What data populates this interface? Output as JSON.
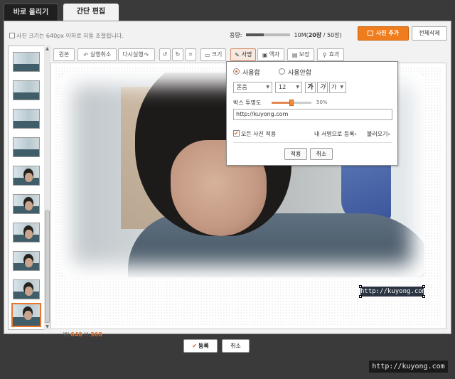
{
  "tabs": {
    "upload": "바로 올리기",
    "edit": "간단 편집"
  },
  "topbar": {
    "note": "사진 크기는 640px 이하로 자동 조절됩니다.",
    "capacity_label": "용량:",
    "capacity_total": "10M",
    "photo_count_open": "(",
    "photo_count_current": "20장",
    "photo_count_rest": " / 50장)",
    "capacity_fill": 0.4,
    "add_photo": "사진 추가",
    "delete_all": "전체삭제"
  },
  "toolbar": {
    "original": "원본",
    "undo": "실행취소",
    "redo": "다시실행",
    "resize": "크기",
    "signature": "서명",
    "stamp": "액자",
    "correct": "보정",
    "effect": "효과"
  },
  "photo": {
    "watermark": "http://kuyong.com"
  },
  "dims": {
    "w_label": "W:",
    "w_value": "640",
    "h_label": " H:",
    "h_value": "360"
  },
  "signature_panel": {
    "use": "사용함",
    "no_use": "사용안함",
    "font": "돋움",
    "size": "12",
    "bold": "가",
    "italic": "가",
    "color": "가",
    "opacity_label": "박스 투명도",
    "opacity_value": "50%",
    "opacity_fraction": 0.5,
    "text_value": "http://kuyong.com",
    "apply_all": "모든 사진 적용",
    "register": "내 서명으로 등록",
    "load": "불러오기",
    "apply": "적용",
    "cancel": "취소"
  },
  "footer": {
    "submit": "등록",
    "cancel": "취소"
  },
  "site_watermark": "http://kuyong.com",
  "colors": {
    "accent": "#f07d1d",
    "selected": "#e8762d"
  }
}
